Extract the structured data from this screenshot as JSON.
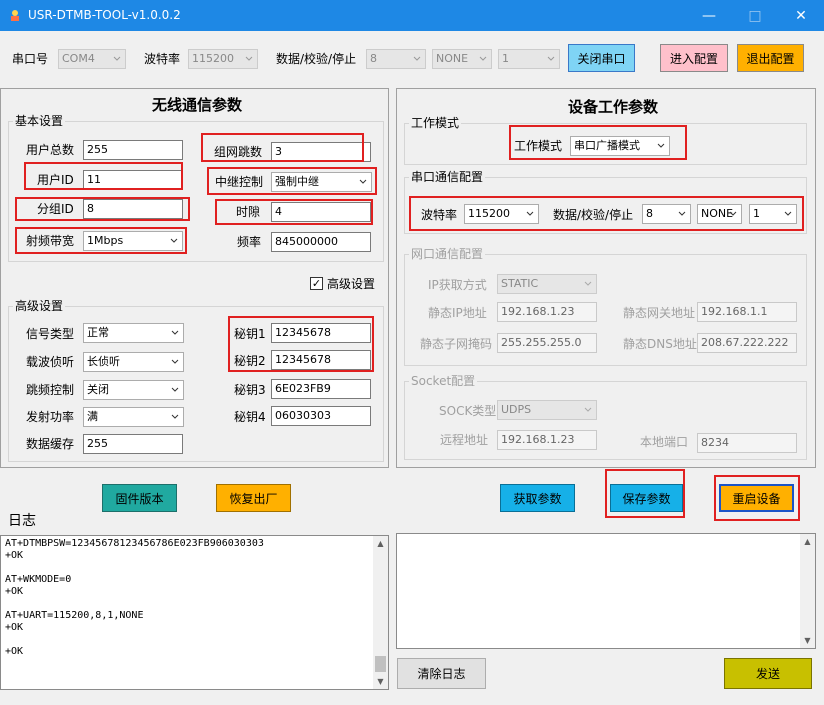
{
  "window": {
    "title": "USR-DTMB-TOOL-v1.0.0.2",
    "minimize": "—",
    "maximize": "□",
    "close": "✕"
  },
  "top": {
    "port_label": "串口号",
    "port_value": "COM4",
    "baud_label": "波特率",
    "baud_value": "115200",
    "data_label": "数据/校验/停止",
    "data_bits": "8",
    "parity": "NONE",
    "stop_bits": "1",
    "close_port": "关闭串口",
    "enter_config": "进入配置",
    "exit_config": "退出配置"
  },
  "wireless": {
    "title": "无线通信参数",
    "basic_group": "基本设置",
    "total_users_label": "用户总数",
    "total_users": "255",
    "net_hop_label": "组网跳数",
    "net_hop": "3",
    "user_id_label": "用户ID",
    "user_id": "11",
    "relay_label": "中继控制",
    "relay_value": "强制中继",
    "group_id_label": "分组ID",
    "group_id": "8",
    "slot_label": "时隙",
    "slot": "4",
    "bandwidth_label": "射频带宽",
    "bandwidth": "1Mbps",
    "freq_label": "频率",
    "freq": "845000000",
    "advanced_check_label": "高级设置",
    "check_mark": "✓",
    "adv_group": "高级设置",
    "signal_type_label": "信号类型",
    "signal_type": "正常",
    "carrier_label": "载波侦听",
    "carrier": "长侦听",
    "hop_ctrl_label": "跳频控制",
    "hop_ctrl": "关闭",
    "tx_power_label": "发射功率",
    "tx_power": "满",
    "buffer_label": "数据缓存",
    "buffer": "255",
    "key1_label": "秘钥1",
    "key1": "12345678",
    "key2_label": "秘钥2",
    "key2": "12345678",
    "key3_label": "秘钥3",
    "key3": "6E023FB9",
    "key4_label": "秘钥4",
    "key4": "06030303"
  },
  "device": {
    "title": "设备工作参数",
    "mode_group": "工作模式",
    "mode_label": "工作模式",
    "mode_value": "串口广播模式",
    "serial_group": "串口通信配置",
    "baud_label": "波特率",
    "baud_value": "115200",
    "data_label": "数据/校验/停止",
    "data_bits": "8",
    "parity": "NONE",
    "stop_bits": "1",
    "net_group": "网口通信配置",
    "ip_mode_label": "IP获取方式",
    "ip_mode": "STATIC",
    "static_ip_label": "静态IP地址",
    "static_ip": "192.168.1.23",
    "gateway_label": "静态网关地址",
    "gateway": "192.168.1.1",
    "mask_label": "静态子网掩码",
    "mask": "255.255.255.0",
    "dns_label": "静态DNS地址",
    "dns": "208.67.222.222",
    "socket_group": "Socket配置",
    "sock_type_label": "SOCK类型",
    "sock_type": "UDPS",
    "remote_label": "远程地址",
    "remote": "192.168.1.23",
    "local_port_label": "本地端口",
    "local_port": "8234"
  },
  "actions": {
    "firmware": "固件版本",
    "factory": "恢复出厂",
    "get_params": "获取参数",
    "save_params": "保存参数",
    "restart": "重启设备"
  },
  "log": {
    "label": "日志",
    "text": "AT+DTMBPSW=12345678123456786E023FB906030303\n+OK\n\nAT+WKMODE=0\n+OK\n\nAT+UART=115200,8,1,NONE\n+OK\n\n+OK",
    "clear": "清除日志",
    "send": "发送",
    "up": "▲",
    "down": "▼"
  },
  "colors": {
    "titlebar": "#1e88e5",
    "teal": "#20a9a0",
    "orange": "#ffb000",
    "blue": "#16b0e8",
    "cyan_light": "#7fd4f5",
    "pink": "#ffc0cb",
    "olive": "#c8c000",
    "highlight_red": "#e02020"
  }
}
